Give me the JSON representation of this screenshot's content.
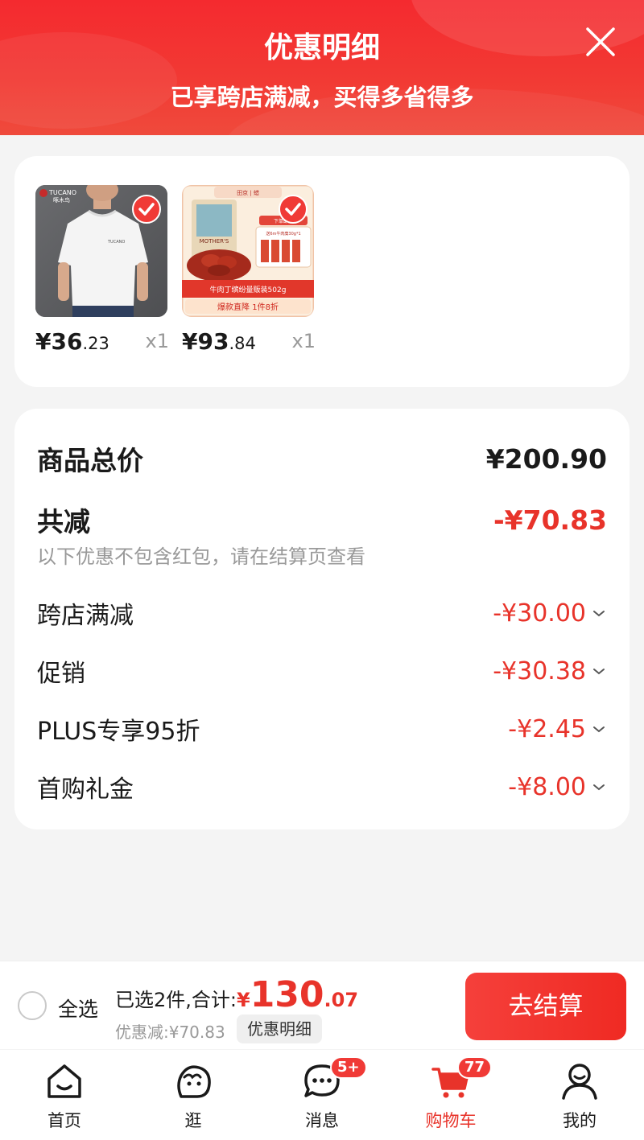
{
  "header": {
    "title": "优惠明细",
    "subtitle": "已享跨店满减，买得多省得多"
  },
  "products": [
    {
      "price_int": "¥36",
      "price_dec": ".23",
      "qty": "x1",
      "brand_text": "TUCANO",
      "brand_sub": "啄木鸟",
      "shirt_text": "TUCANO"
    },
    {
      "price_int": "¥93",
      "price_dec": ".84",
      "qty": "x1",
      "top_text": "田京 | 蜡",
      "pkg_text": "MOTHER'S",
      "tag_text": "下单即赠",
      "gift_text": "送6m牛肉糜30g*1",
      "caption": "牛肉丁缤纷量贩装502g",
      "promo": "爆款直降 1件8折"
    }
  ],
  "summary": {
    "total_label": "商品总价",
    "total_value": "¥200.90",
    "reduce_label": "共减",
    "reduce_value": "-¥70.83",
    "note": "以下优惠不包含红包，请在结算页查看",
    "items": [
      {
        "label": "跨店满减",
        "value": "-¥30.00"
      },
      {
        "label": "促销",
        "value": "-¥30.38"
      },
      {
        "label": "PLUS专享95折",
        "value": "-¥2.45"
      },
      {
        "label": "首购礼金",
        "value": "-¥8.00"
      }
    ]
  },
  "bottom_bar": {
    "select_all": "全选",
    "selected_label": "已选2件,合计:",
    "currency": "¥",
    "total_int": "130",
    "total_dec": ".07",
    "discount_text": "优惠减:¥70.83",
    "detail_chip": "优惠明细",
    "checkout": "去结算"
  },
  "tabbar": [
    {
      "label": "首页",
      "icon": "home-icon"
    },
    {
      "label": "逛",
      "icon": "browse-icon"
    },
    {
      "label": "消息",
      "icon": "message-icon",
      "badge": "5+"
    },
    {
      "label": "购物车",
      "icon": "cart-icon",
      "badge": "77",
      "active": true
    },
    {
      "label": "我的",
      "icon": "profile-icon"
    }
  ],
  "colors": {
    "accent": "#f03a36",
    "discount_red": "#e8332a",
    "background": "#f4f4f4"
  }
}
